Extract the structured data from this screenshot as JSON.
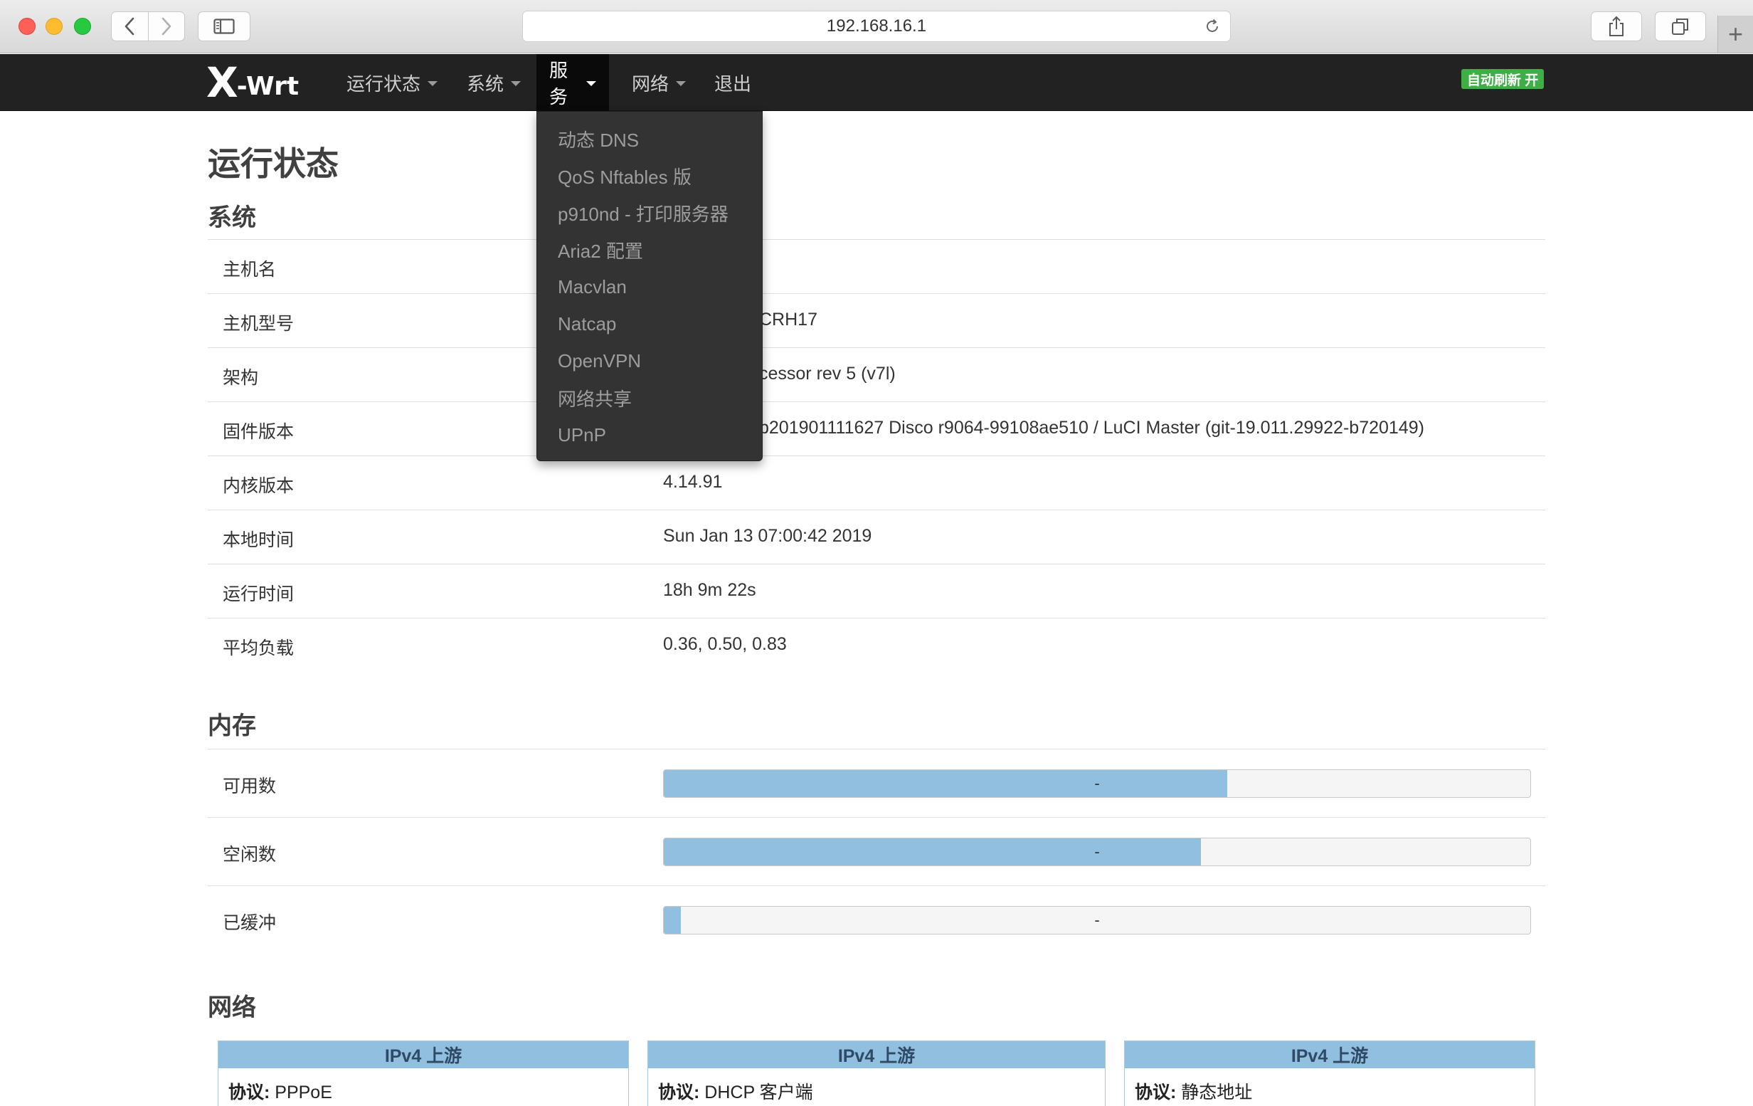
{
  "browser": {
    "url": "192.168.16.1"
  },
  "navbar": {
    "brand_big": "X",
    "brand_small": "-Wrt",
    "menus": [
      {
        "label": "运行状态"
      },
      {
        "label": "系统"
      },
      {
        "label": "服务"
      },
      {
        "label": "网络"
      },
      {
        "label": "退出"
      }
    ],
    "autorefresh": "自动刷新 开",
    "active_menu": "服务"
  },
  "dropdown": {
    "items": [
      "动态 DNS",
      "QoS Nftables 版",
      "p910nd - 打印服务器",
      "Aria2 配置",
      "Macvlan",
      "Natcap",
      "OpenVPN",
      "网络共享",
      "UPnP"
    ]
  },
  "page": {
    "title": "运行状态"
  },
  "system": {
    "heading": "系统",
    "rows": [
      {
        "label": "主机名",
        "value": ""
      },
      {
        "label": "主机型号",
        "value": "CRH17"
      },
      {
        "label": "架构",
        "value": "cessor rev 5 (v7l)"
      },
      {
        "label": "固件版本",
        "value": "b201901111627 Disco r9064-99108ae510 / LuCI Master (git-19.011.29922-b720149)"
      },
      {
        "label": "内核版本",
        "value": "4.14.91"
      },
      {
        "label": "本地时间",
        "value": "Sun Jan 13 07:00:42 2019"
      },
      {
        "label": "运行时间",
        "value": "18h 9m 22s"
      },
      {
        "label": "平均负载",
        "value": "0.36, 0.50, 0.83"
      }
    ]
  },
  "memory": {
    "heading": "内存",
    "rows": [
      {
        "label": "可用数",
        "text": "-",
        "fraction": 0.65
      },
      {
        "label": "空闲数",
        "text": "-",
        "fraction": 0.62
      },
      {
        "label": "已缓冲",
        "text": "-",
        "fraction": 0.02
      }
    ]
  },
  "network": {
    "heading": "网络",
    "cards": [
      {
        "title": "IPv4 上游",
        "proto_label": "协议:",
        "proto_value": "PPPoE"
      },
      {
        "title": "IPv4 上游",
        "proto_label": "协议:",
        "proto_value": "DHCP 客户端"
      },
      {
        "title": "IPv4 上游",
        "proto_label": "协议:",
        "proto_value": "静态地址"
      }
    ]
  },
  "colors": {
    "navbar_bg": "#222222",
    "dropdown_bg": "#333333",
    "progress_fill": "#90bfe0",
    "autorefresh_badge": "#3fae46",
    "card_header": "#90bfe0"
  }
}
